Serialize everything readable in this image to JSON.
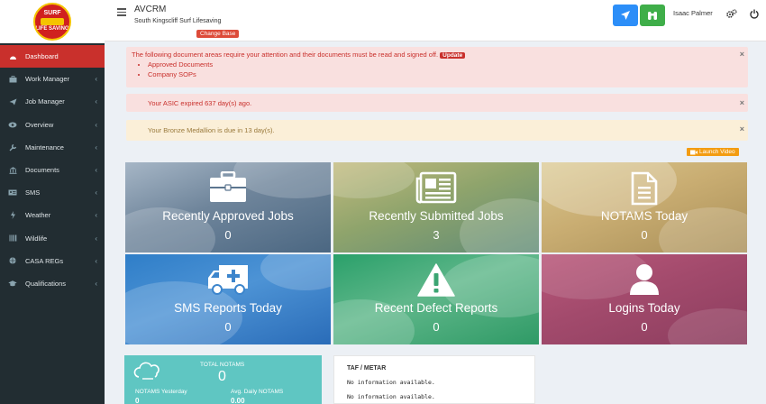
{
  "sidebar": {
    "items": [
      {
        "label": "Dashboard",
        "icon": "dashboard-icon",
        "active": true
      },
      {
        "label": "Work Manager",
        "icon": "briefcase-icon"
      },
      {
        "label": "Job Manager",
        "icon": "send-icon"
      },
      {
        "label": "Overview",
        "icon": "eye-icon"
      },
      {
        "label": "Maintenance",
        "icon": "wrench-icon"
      },
      {
        "label": "Documents",
        "icon": "bank-icon"
      },
      {
        "label": "SMS",
        "icon": "id-card-icon"
      },
      {
        "label": "Weather",
        "icon": "bolt-icon"
      },
      {
        "label": "Wildlife",
        "icon": "barcode-icon"
      },
      {
        "label": "CASA REGs",
        "icon": "globe-icon"
      },
      {
        "label": "Qualifications",
        "icon": "graduation-cap-icon"
      }
    ],
    "chevron": "‹"
  },
  "header": {
    "app_title": "AVCRM",
    "base_name": "South Kingscliff Surf Lifesaving",
    "change_base_label": "Change Base",
    "user_name": "Isaac Palmer",
    "colors": {
      "plane_btn": "#2c8ef8",
      "binoc_btn": "#3fae49"
    }
  },
  "alerts": {
    "documents": {
      "text": "The following document areas require your attention and their documents must be read and signed off.",
      "update_label": "Update",
      "items": [
        "Approved Documents",
        "Company SOPs"
      ]
    },
    "asic": "Your ASIC expired 637 day(s) ago.",
    "bronze": "Your Bronze Medallion is due in 13 day(s).",
    "close_glyph": "×"
  },
  "launch_video_label": "Launch Video",
  "tiles": [
    {
      "label": "Recently Approved Jobs",
      "count": "0",
      "icon": "toolbox-icon"
    },
    {
      "label": "Recently Submitted Jobs",
      "count": "3",
      "icon": "newspaper-icon"
    },
    {
      "label": "NOTAMS Today",
      "count": "0",
      "icon": "document-icon"
    },
    {
      "label": "SMS Reports Today",
      "count": "0",
      "icon": "ambulance-icon"
    },
    {
      "label": "Recent Defect Reports",
      "count": "0",
      "icon": "warning-icon"
    },
    {
      "label": "Logins Today",
      "count": "0",
      "icon": "user-icon"
    }
  ],
  "notams": {
    "total_label": "TOTAL NOTAMS",
    "total_value": "0",
    "yesterday_label": "NOTAMS Yesterday",
    "yesterday_value": "0",
    "avg_label": "Avg. Daily NOTAMS",
    "avg_value": "0.00"
  },
  "taf": {
    "title": "TAF / METAR",
    "line1": "No information available.",
    "line2": "No information available."
  }
}
